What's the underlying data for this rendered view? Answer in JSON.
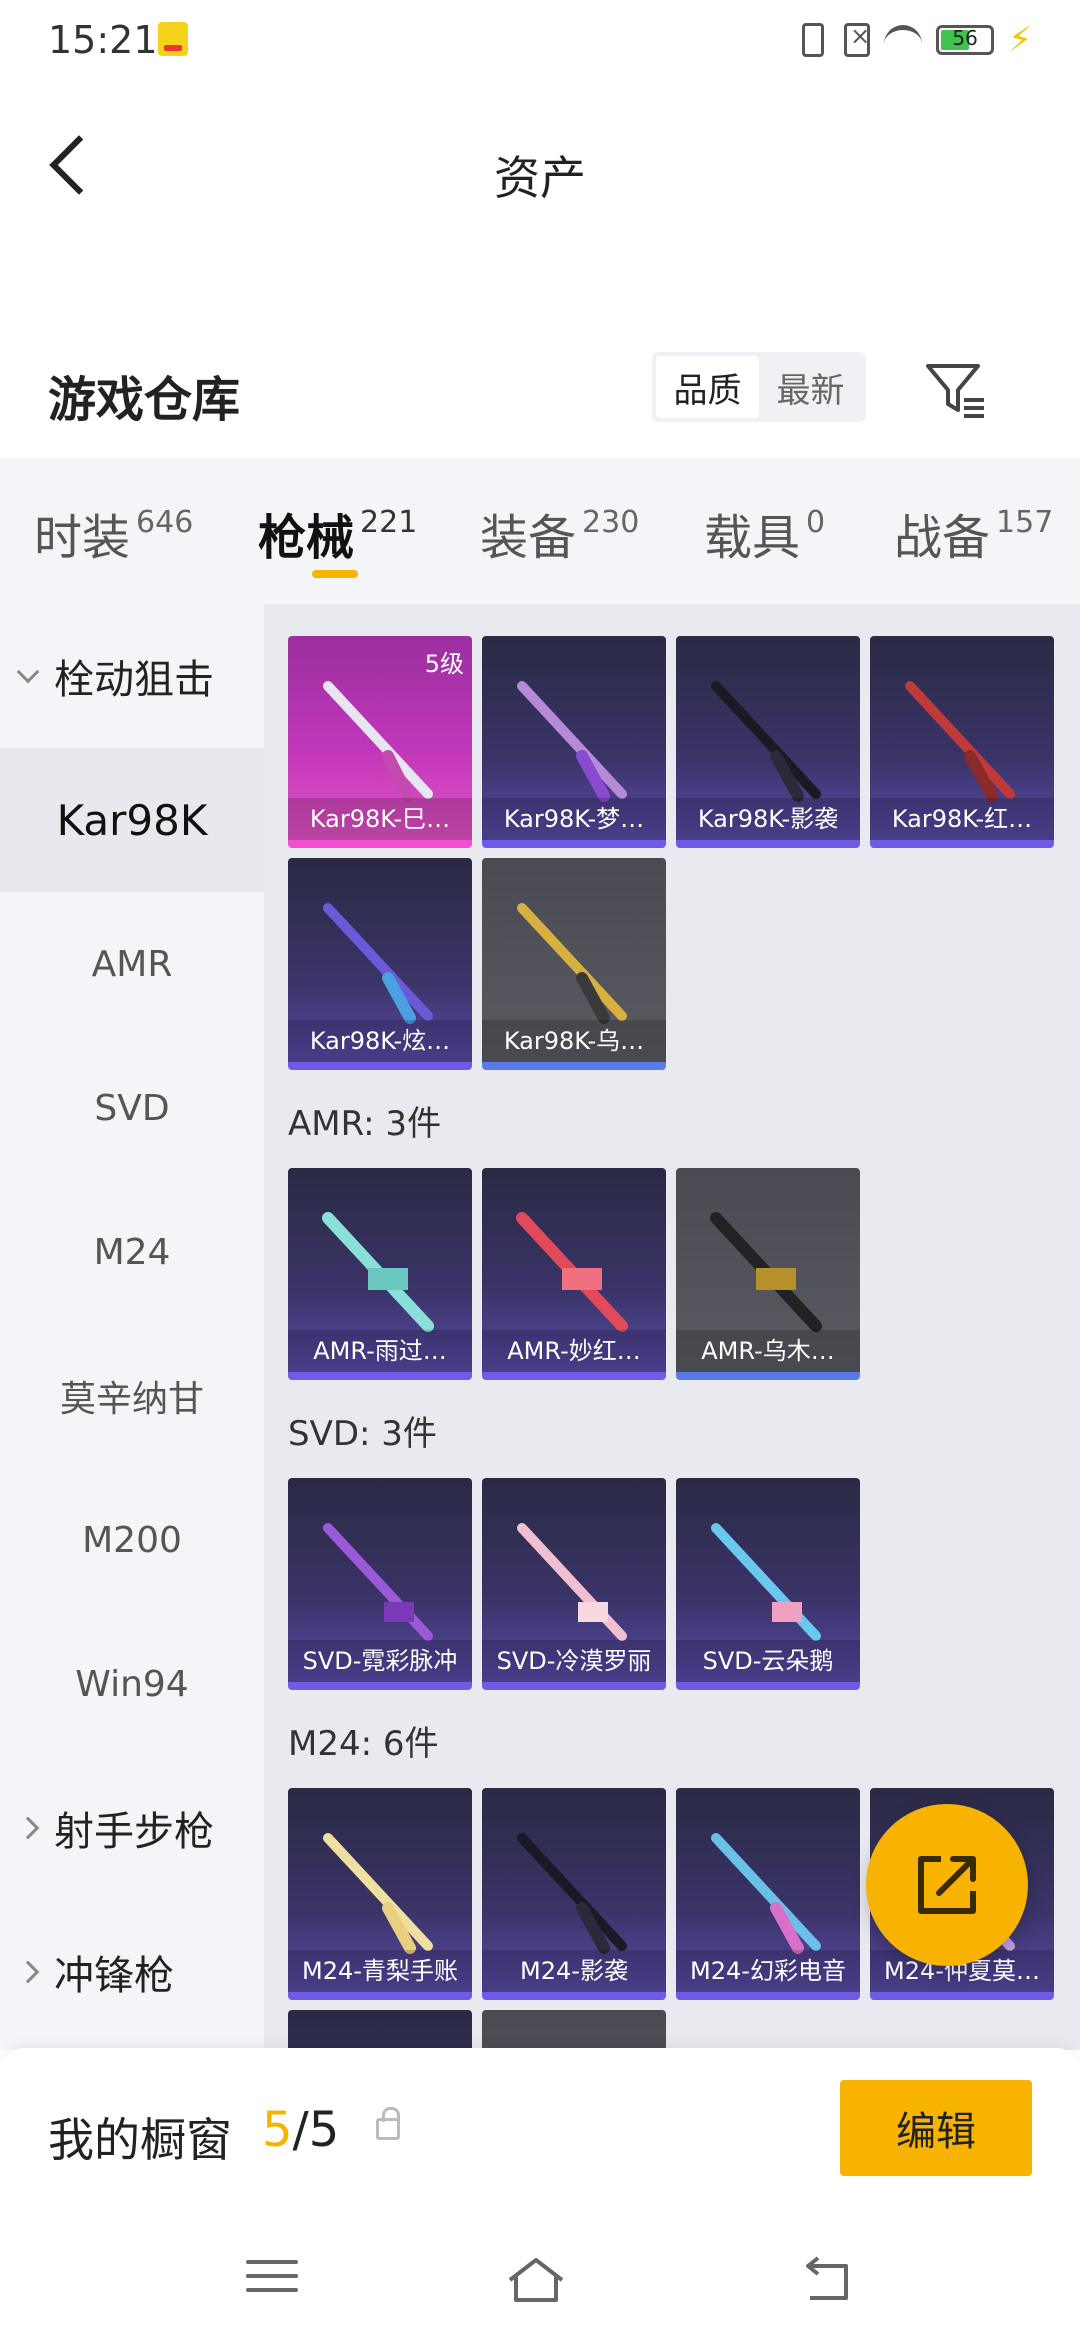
{
  "status_bar": {
    "time": "15:21",
    "battery": "56"
  },
  "header": {
    "title": "资产"
  },
  "warehouse": {
    "title": "游戏仓库",
    "sort_options": [
      "品质",
      "最新"
    ]
  },
  "category_tabs": [
    {
      "label": "时装",
      "count": "646"
    },
    {
      "label": "枪械",
      "count": "221"
    },
    {
      "label": "装备",
      "count": "230"
    },
    {
      "label": "载具",
      "count": "0"
    },
    {
      "label": "战备",
      "count": "157"
    }
  ],
  "sidebar": {
    "group_bolt": "栓动狙击",
    "items": [
      "Kar98K",
      "AMR",
      "SVD",
      "M24",
      "莫辛纳甘",
      "M200",
      "Win94"
    ],
    "group_marksman": "射手步枪",
    "group_smg": "冲锋枪"
  },
  "content": {
    "kar98k_cards": [
      "Kar98K-巳…",
      "Kar98K-梦…",
      "Kar98K-影袭",
      "Kar98K-红…",
      "Kar98K-炫…",
      "Kar98K-乌…"
    ],
    "kar98k_first_level": "5级",
    "amr_header": "AMR: 3件",
    "amr_cards": [
      "AMR-雨过…",
      "AMR-妙红…",
      "AMR-乌木…"
    ],
    "svd_header": "SVD: 3件",
    "svd_cards": [
      "SVD-霓彩脉冲",
      "SVD-冷漠罗丽",
      "SVD-云朵鹅"
    ],
    "m24_header": "M24: 6件",
    "m24_cards": [
      "M24-青梨手账",
      "M24-影袭",
      "M24-幻彩电音",
      "M24-仲夏莫…"
    ]
  },
  "showcase": {
    "label": "我的橱窗",
    "current": "5",
    "separator": "/",
    "total": "5",
    "edit_label": "编辑"
  },
  "colors": {
    "accent": "#f8b300",
    "selected_tab_underline": "#f5b400"
  }
}
